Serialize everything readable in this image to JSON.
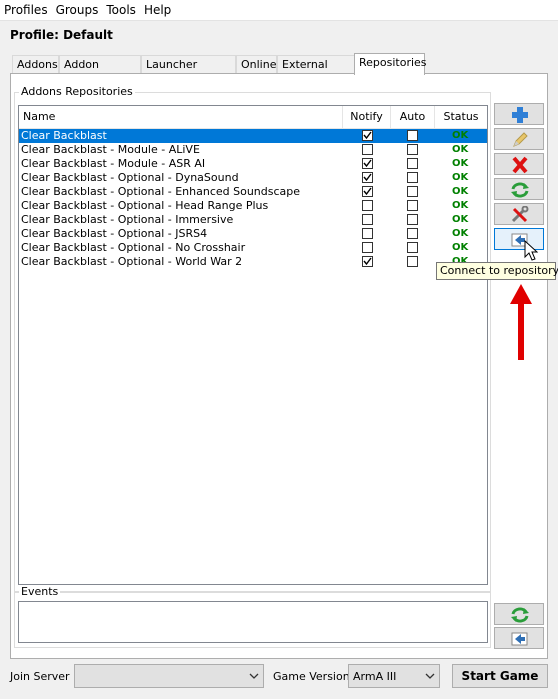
{
  "menu": {
    "items": [
      "Profiles",
      "Groups",
      "Tools",
      "Help"
    ]
  },
  "profile": {
    "label": "Profile: Default"
  },
  "tabs": [
    "Addons",
    "Addon Options",
    "Launcher Options",
    "Online",
    "External Apps",
    "Repositories"
  ],
  "active_tab": "Repositories",
  "repositories": {
    "group_title": "Addons Repositories",
    "columns": {
      "name": "Name",
      "notify": "Notify",
      "auto": "Auto",
      "status": "Status"
    },
    "rows": [
      {
        "name": "Clear Backblast",
        "notify": true,
        "auto": false,
        "status": "OK",
        "selected": true
      },
      {
        "name": "Clear Backblast - Module - ALiVE",
        "notify": false,
        "auto": false,
        "status": "OK"
      },
      {
        "name": "Clear Backblast - Module - ASR AI",
        "notify": true,
        "auto": false,
        "status": "OK"
      },
      {
        "name": "Clear Backblast - Optional - DynaSound",
        "notify": true,
        "auto": false,
        "status": "OK"
      },
      {
        "name": "Clear Backblast - Optional - Enhanced Soundscape",
        "notify": true,
        "auto": false,
        "status": "OK"
      },
      {
        "name": "Clear Backblast - Optional - Head Range Plus",
        "notify": false,
        "auto": false,
        "status": "OK"
      },
      {
        "name": "Clear Backblast - Optional - Immersive",
        "notify": false,
        "auto": false,
        "status": "OK"
      },
      {
        "name": "Clear Backblast - Optional - JSRS4",
        "notify": false,
        "auto": false,
        "status": "OK"
      },
      {
        "name": "Clear Backblast - Optional - No Crosshair",
        "notify": false,
        "auto": false,
        "status": "OK"
      },
      {
        "name": "Clear Backblast - Optional - World War 2",
        "notify": true,
        "auto": false,
        "status": "OK"
      }
    ]
  },
  "side_buttons": [
    "add-icon",
    "edit-icon",
    "delete-icon",
    "refresh-icon",
    "settings-icon",
    "connect-icon"
  ],
  "tooltip": "Connect to repository",
  "events": {
    "group_title": "Events"
  },
  "bottom": {
    "join_server_label": "Join Server",
    "join_server_value": "",
    "game_version_label": "Game Version",
    "game_version_value": "ArmA III",
    "start_button": "Start Game"
  },
  "colors": {
    "selection": "#0078d7",
    "status_ok": "#008000",
    "annotation_arrow": "#e00000"
  }
}
